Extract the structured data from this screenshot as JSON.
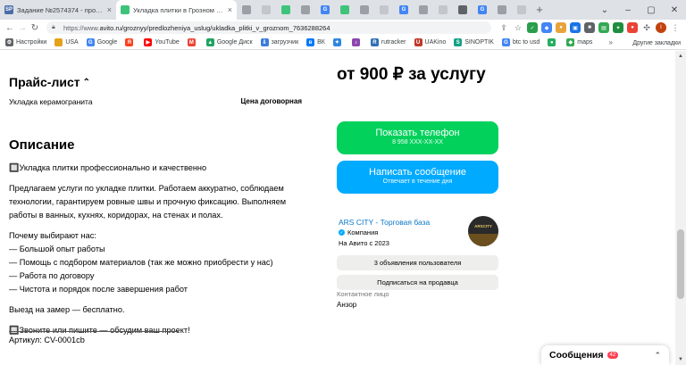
{
  "tabs": [
    {
      "title": "Задание №2574374 - просмотр з",
      "icon": "sp-icon",
      "color": "#4a6da7",
      "text": "SP"
    },
    {
      "title": "Укладка плитки в Грозном в Гро",
      "icon": "avito-icon",
      "color": "#3ec47a",
      "text": ""
    }
  ],
  "address": {
    "url": "avito.ru/groznyy/predlozheniya_uslug/ukladka_plitki_v_groznom_7636288264",
    "prefix": "https://www."
  },
  "bookmarks": [
    {
      "label": "Настройки",
      "icon": "settings-icon",
      "color": "#5f6368",
      "g": "⚙"
    },
    {
      "label": "USA",
      "icon": "folder-icon",
      "color": "#e3a21a",
      "g": ""
    },
    {
      "label": "Google",
      "icon": "google-icon",
      "color": "#4285f4",
      "g": "G"
    },
    {
      "label": "",
      "icon": "yandex-icon",
      "color": "#fc3f1d",
      "g": "Я"
    },
    {
      "label": "YouTube",
      "icon": "youtube-icon",
      "color": "#ff0000",
      "g": "▶"
    },
    {
      "label": "",
      "icon": "gmail-icon",
      "color": "#ea4335",
      "g": "M"
    },
    {
      "label": "Google Диск",
      "icon": "gdrive-icon",
      "color": "#1ea362",
      "g": "▲"
    },
    {
      "label": "загрузчик",
      "icon": "downloader-icon",
      "color": "#3b7dd8",
      "g": "⇩"
    },
    {
      "label": "ВК",
      "icon": "vk-icon",
      "color": "#0077ff",
      "g": "в"
    },
    {
      "label": "",
      "icon": "bookmark-icon",
      "color": "#2e86de",
      "g": "✦"
    },
    {
      "label": "",
      "icon": "bookmark-icon",
      "color": "#8e44ad",
      "g": "♪"
    },
    {
      "label": "rutracker",
      "icon": "rutracker-icon",
      "color": "#2f6fb3",
      "g": "R"
    },
    {
      "label": "UAKino",
      "icon": "uakino-icon",
      "color": "#c0392b",
      "g": "U"
    },
    {
      "label": "SINOPTIK",
      "icon": "sinoptik-icon",
      "color": "#16a085",
      "g": "S"
    },
    {
      "label": "btc to usd",
      "icon": "google-icon",
      "color": "#4285f4",
      "g": "G"
    },
    {
      "label": "",
      "icon": "bookmark-icon",
      "color": "#27ae60",
      "g": "●"
    },
    {
      "label": "maps",
      "icon": "maps-icon",
      "color": "#34a853",
      "g": "◆"
    }
  ],
  "bookmarks_other": "Другие закладки",
  "page": {
    "price_list_title": "Прайс-лист",
    "price_item": "Укладка керамогранита",
    "price_value": "Цена договорная",
    "description_title": "Описание",
    "description_lines": [
      "🔲Укладка плитки профессионально и качественно",
      "",
      "Предлагаем услуги по укладке плитки. Работаем аккуратно, соблюдаем",
      "технологии, гарантируем ровные швы и прочную фиксацию. Выполняем",
      "работы в ванных, кухнях, коридорах, на стенах и полах.",
      "",
      "Почему выбирают нас:",
      "— Большой опыт работы",
      "— Помощь с подбором материалов (так же можно приобрести у нас)",
      "— Работа по договору",
      "— Чистота и порядок после завершения работ",
      "",
      "Выезд на замер — бесплатно.",
      "",
      "🔲Звоните или пишите — обсудим ваш проект!"
    ],
    "article": "Артикул: CV-0001cb",
    "big_price": "от 900 ₽ за услугу",
    "phone_button": "Показать телефон",
    "phone_number": "8 958 XXX-XX-XX",
    "message_button": "Написать сообщение",
    "message_sub": "Отвечает в течение дня",
    "seller_name": "ARS CITY - Торговая база",
    "seller_type": "Компания",
    "seller_since": "На Авито с 2023",
    "avatar_text": "ARSCITY",
    "listings_button": "3 объявления пользователя",
    "subscribe_button": "Подписаться на продавца",
    "contact_label": "Контактное лицо",
    "contact_name": "Анзор",
    "messages_label": "Сообщения",
    "messages_badge": "42"
  }
}
